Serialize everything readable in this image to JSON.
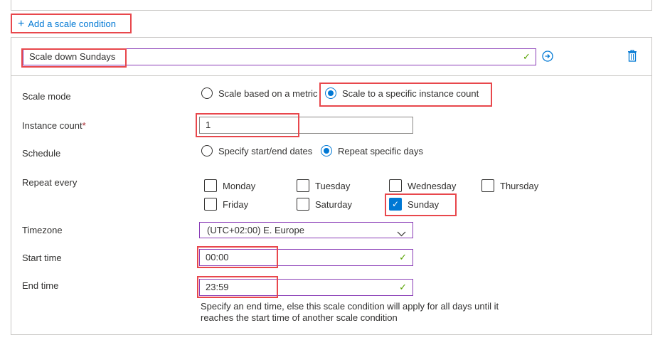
{
  "add_condition": {
    "label": "Add a scale condition"
  },
  "condition": {
    "name": "Scale down Sundays",
    "icons": {
      "valid": "checkmark-icon",
      "navigate": "arrow-right-circle-icon",
      "delete": "trash-icon"
    },
    "colors": {
      "accent": "#0078d4",
      "highlight": "#e8474c",
      "valid": "#57a300",
      "focus": "#8a3db7"
    }
  },
  "scale_mode": {
    "label": "Scale mode",
    "options": [
      "Scale based on a metric",
      "Scale to a specific instance count"
    ],
    "selected": "Scale to a specific instance count"
  },
  "instance_count": {
    "label": "Instance count",
    "required_mark": "*",
    "value": "1"
  },
  "schedule": {
    "label": "Schedule",
    "options": [
      "Specify start/end dates",
      "Repeat specific days"
    ],
    "selected": "Repeat specific days"
  },
  "repeat_every": {
    "label": "Repeat every",
    "days": [
      {
        "name": "Monday",
        "checked": false
      },
      {
        "name": "Tuesday",
        "checked": false
      },
      {
        "name": "Wednesday",
        "checked": false
      },
      {
        "name": "Thursday",
        "checked": false
      },
      {
        "name": "Friday",
        "checked": false
      },
      {
        "name": "Saturday",
        "checked": false
      },
      {
        "name": "Sunday",
        "checked": true
      }
    ]
  },
  "timezone": {
    "label": "Timezone",
    "value": "(UTC+02:00) E. Europe"
  },
  "start_time": {
    "label": "Start time",
    "value": "00:00"
  },
  "end_time": {
    "label": "End time",
    "value": "23:59",
    "hint": "Specify an end time, else this scale condition will apply for all days until it reaches the start time of another scale condition"
  }
}
